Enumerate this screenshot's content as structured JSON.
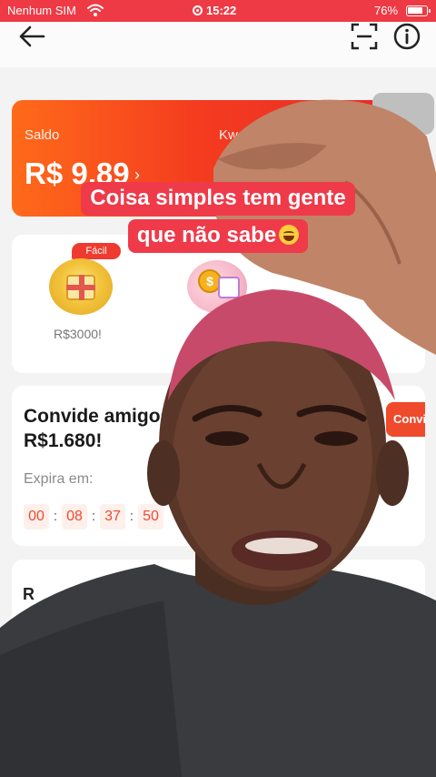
{
  "status_bar": {
    "carrier": "Nenhum SIM",
    "time": "15:22",
    "battery": "76%"
  },
  "top_bar": {
    "icons": [
      "back-arrow-icon",
      "scan-icon",
      "info-icon"
    ]
  },
  "balance": {
    "label": "Saldo",
    "amount": "R$ 9,89",
    "arrow": "›",
    "partner_label": "Kwai C"
  },
  "tasks": {
    "badge": "Fácil",
    "reward": "R$3000!"
  },
  "invite": {
    "title": "Convide amigos",
    "amount": "R$1.680!",
    "expira_label": "Expira em:",
    "countdown": [
      "00",
      "08",
      "37",
      "50"
    ],
    "button_label": "Convida"
  },
  "card4": {
    "title": "R"
  },
  "caption": {
    "line1": "Coisa simples  tem gente",
    "line2": "que não sabe"
  },
  "colors": {
    "status_bar": "#ee3a44",
    "accent": "#ef4a2c",
    "caption_bg": "#ef3a4a"
  }
}
